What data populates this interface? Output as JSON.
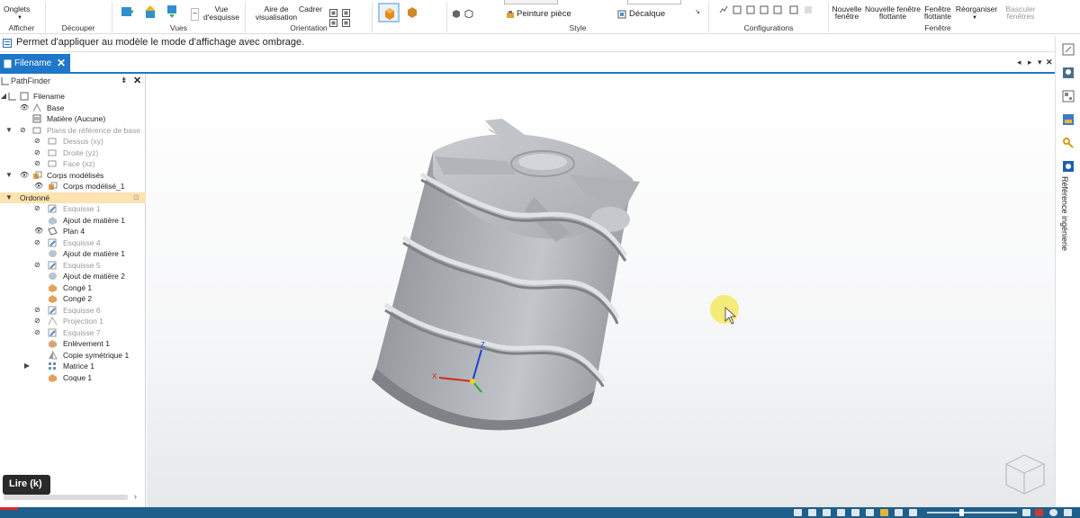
{
  "ribbon": {
    "onglets": "Onglets",
    "afficher": "Afficher",
    "decouper": "Découper",
    "vues": "Vues",
    "vue_esquisse_1": "Vue",
    "vue_esquisse_2": "d'esquisse",
    "aire_1": "Aire de",
    "aire_2": "visualisation",
    "cadrer": "Cadrer",
    "orientation": "Orientation",
    "peinture_piece": "Peinture pièce",
    "decalque": "Décalque",
    "style": "Style",
    "configurations": "Configurations",
    "nouvelle_fenetre_1": "Nouvelle",
    "nouvelle_fenetre_2": "fenêtre",
    "nf_flottante_1": "Nouvelle fenêtre",
    "nf_flottante_2": "flottante",
    "fenetre_flottante_1": "Fenêtre",
    "fenetre_flottante_2": "flottante",
    "reorganiser": "Réorganiser",
    "basculer_1": "Basculer",
    "basculer_2": "fenêtres",
    "fenetre": "Fenêtre"
  },
  "prompt": "Permet d'appliquer au modèle le mode d'affichage avec ombrage.",
  "tab": {
    "label": "Filename"
  },
  "pathfinder": {
    "title": "PathFinder",
    "items": [
      {
        "label": "Filename"
      },
      {
        "label": "Base"
      },
      {
        "label": "Matière (Aucune)"
      },
      {
        "label": "Plans de référence de base"
      },
      {
        "label": "Dessus (xy)"
      },
      {
        "label": "Droite (yz)"
      },
      {
        "label": "Face (xz)"
      },
      {
        "label": "Corps modélisés"
      },
      {
        "label": "Corps modélisé_1"
      },
      {
        "label": "Ordonné"
      },
      {
        "label": "Esquisse 1"
      },
      {
        "label": "Ajout de matière 1"
      },
      {
        "label": "Plan 4"
      },
      {
        "label": "Esquisse 4"
      },
      {
        "label": "Ajout de matière 1"
      },
      {
        "label": "Esquisse 5"
      },
      {
        "label": "Ajout de matière 2"
      },
      {
        "label": "Congé 1"
      },
      {
        "label": "Congé 2"
      },
      {
        "label": "Esquisse 6"
      },
      {
        "label": "Projection 1"
      },
      {
        "label": "Esquisse 7"
      },
      {
        "label": "Enlèvement 1"
      },
      {
        "label": "Copie symétrique 1"
      },
      {
        "label": "Matrice 1"
      },
      {
        "label": "Coque 1"
      }
    ]
  },
  "video": {
    "lire": "Lire (k)"
  },
  "right_rail": {
    "label": "Référence ingénierie"
  },
  "triad": {
    "z": "Z",
    "x": "X"
  },
  "colors": {
    "accent": "#1f77c9",
    "status_bar": "#1f5f8b",
    "highlight": "#fde3b0",
    "cursor": "#f4e96a"
  }
}
